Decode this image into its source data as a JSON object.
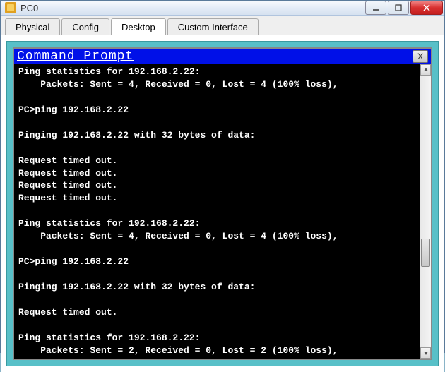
{
  "window": {
    "title": "PC0"
  },
  "tabs": {
    "physical": "Physical",
    "config": "Config",
    "desktop": "Desktop",
    "custom": "Custom Interface"
  },
  "prompt": {
    "title": "Command Prompt",
    "close": "X"
  },
  "terminal_lines": [
    "Ping statistics for 192.168.2.22:",
    "    Packets: Sent = 4, Received = 0, Lost = 4 (100% loss),",
    "",
    "PC>ping 192.168.2.22",
    "",
    "Pinging 192.168.2.22 with 32 bytes of data:",
    "",
    "Request timed out.",
    "Request timed out.",
    "Request timed out.",
    "Request timed out.",
    "",
    "Ping statistics for 192.168.2.22:",
    "    Packets: Sent = 4, Received = 0, Lost = 4 (100% loss),",
    "",
    "PC>ping 192.168.2.22",
    "",
    "Pinging 192.168.2.22 with 32 bytes of data:",
    "",
    "Request timed out.",
    "",
    "Ping statistics for 192.168.2.22:",
    "    Packets: Sent = 2, Received = 0, Lost = 2 (100% loss),",
    ""
  ]
}
